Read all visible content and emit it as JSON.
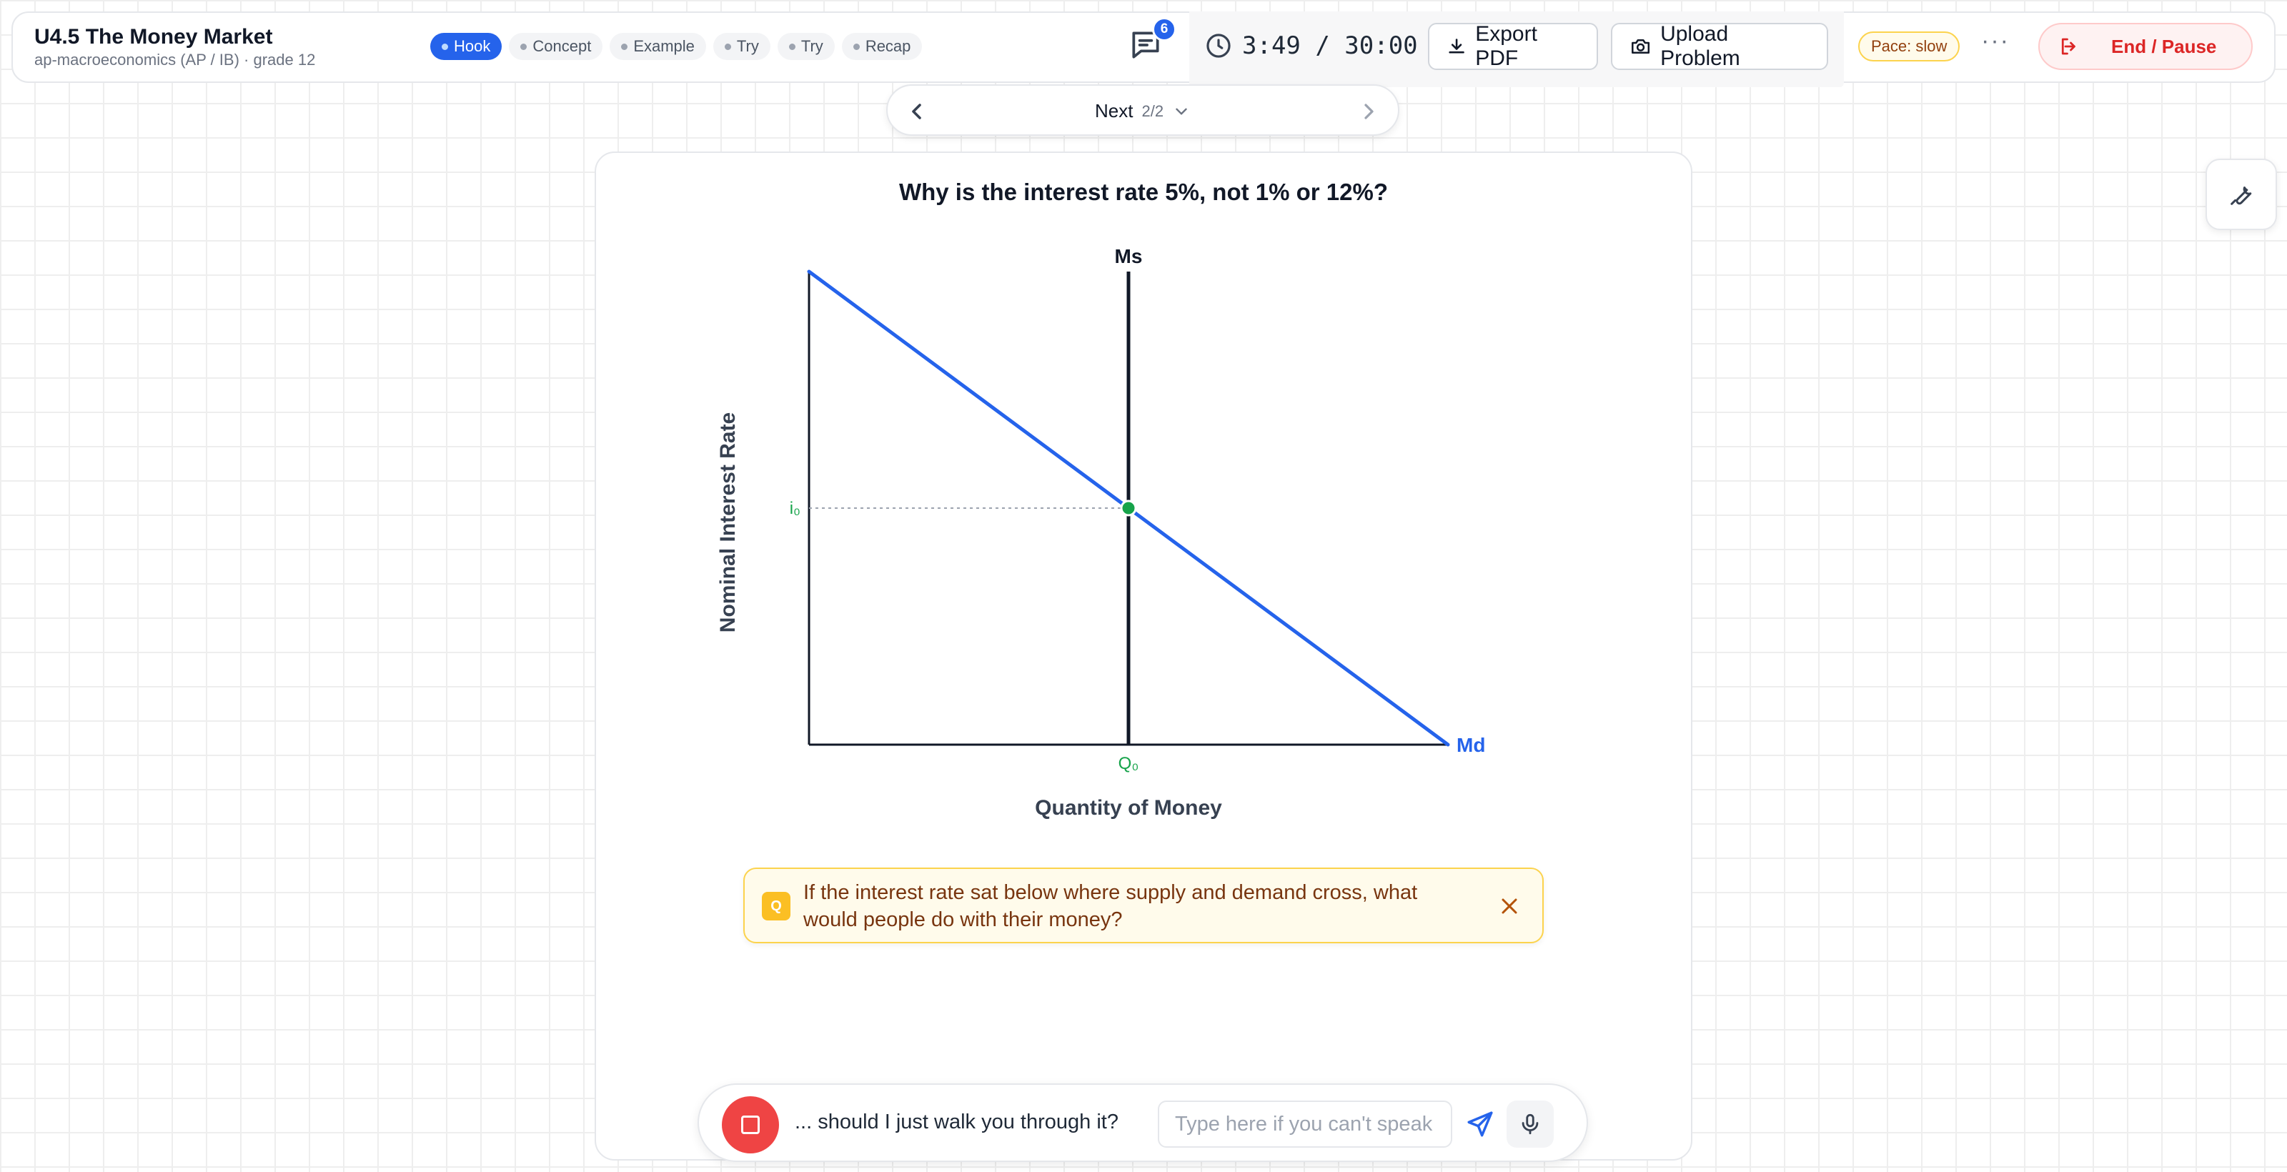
{
  "header": {
    "title": "U4.5 The Money Market",
    "subtitle": "ap-macroeconomics (AP / IB) · grade 12",
    "phases": [
      {
        "label": "Hook",
        "active": true
      },
      {
        "label": "Concept",
        "active": false
      },
      {
        "label": "Example",
        "active": false
      },
      {
        "label": "Try",
        "active": false
      },
      {
        "label": "Try",
        "active": false
      },
      {
        "label": "Recap",
        "active": false
      }
    ],
    "chat_badge": "6",
    "timer": "3:49 / 30:00",
    "export_label": "Export PDF",
    "upload_label": "Upload Problem",
    "pace": "Pace: slow",
    "more_label": "···",
    "end_label": "End / Pause"
  },
  "stepnav": {
    "label": "Next",
    "count": "2/2"
  },
  "card": {
    "question": "Why is the interest rate 5%, not 1% or 12%?"
  },
  "chart_data": {
    "type": "line",
    "title": "",
    "xlabel": "Quantity of Money",
    "ylabel": "Nominal Interest Rate",
    "series": [
      {
        "name": "Ms",
        "kind": "vertical-line",
        "x": 0.5,
        "color": "#111827"
      },
      {
        "name": "Md",
        "kind": "downward-line",
        "points": [
          [
            0,
            1
          ],
          [
            1,
            0
          ]
        ],
        "color": "#2563eb"
      }
    ],
    "equilibrium": {
      "x": 0.5,
      "y": 0.5,
      "x_label": "Q₀",
      "y_label": "i₀",
      "color": "#16a34a"
    },
    "xlim": [
      0,
      1
    ],
    "ylim": [
      0,
      1
    ],
    "grid": false
  },
  "hint": {
    "badge": "Q",
    "text": "If the interest rate sat below where supply and demand cross, what would people do with their money?"
  },
  "voice": {
    "transcript": "... should I just walk you through it?",
    "input_placeholder": "Type here if you can't speak"
  },
  "colors": {
    "accent": "#2563eb",
    "danger": "#ef4444",
    "equilibrium": "#16a34a",
    "hint_bg": "#fffbeb"
  }
}
